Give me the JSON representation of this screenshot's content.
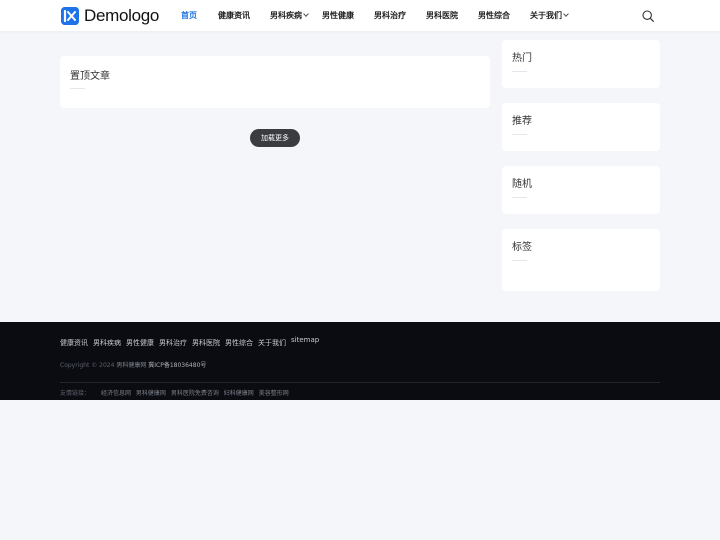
{
  "header": {
    "logo_text": "Demologo",
    "logo_mark": "i✖",
    "nav": [
      {
        "label": "首页",
        "active": true
      },
      {
        "label": "健康资讯"
      },
      {
        "label": "男科疾病",
        "dropdown": true
      },
      {
        "label": "男性健康"
      },
      {
        "label": "男科治疗"
      },
      {
        "label": "男科医院"
      },
      {
        "label": "男性综合"
      },
      {
        "label": "关于我们",
        "dropdown": true
      }
    ],
    "search_icon": "search-icon"
  },
  "main": {
    "sticky_title": "置顶文章",
    "load_more": "加载更多"
  },
  "sidebar": {
    "widgets": [
      "热门",
      "推荐",
      "随机",
      "标签"
    ]
  },
  "footer": {
    "links": [
      "健康资讯",
      "男科疾病",
      "男性健康",
      "男科治疗",
      "男科医院",
      "男性综合",
      "关于我们",
      "sitemap"
    ],
    "copyright_prefix": "Copyright © 2024",
    "site_name": "男科健康网",
    "icp": "冀ICP备18036480号",
    "friend_label": "友情链接：",
    "friend_links": [
      "经济信息网",
      "男科健康网",
      "男科医院免费咨询",
      "妇科健康网",
      "美容整形网"
    ]
  },
  "colors": {
    "accent": "#1e73e8",
    "page_bg": "#f4f6fa",
    "footer_bg": "#0a0c12",
    "button_bg": "#3a3c40"
  }
}
